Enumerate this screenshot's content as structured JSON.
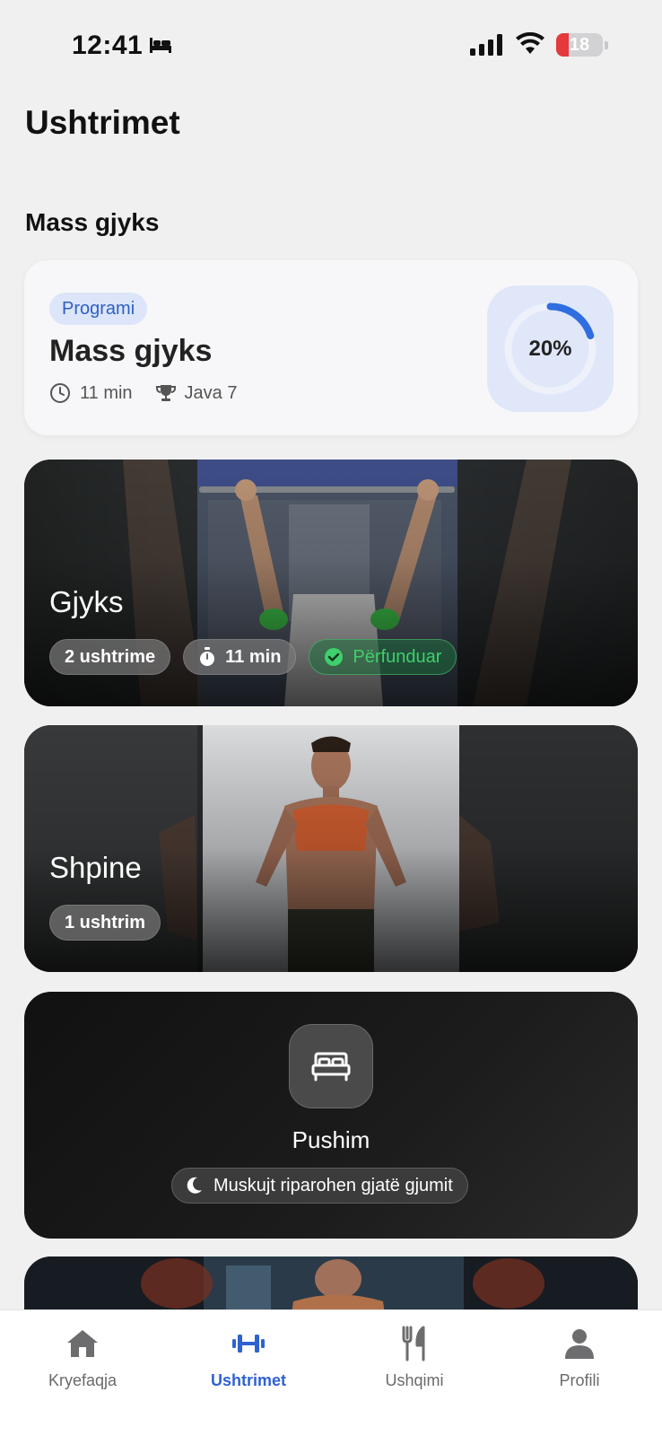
{
  "status": {
    "time": "12:41",
    "battery": "18"
  },
  "header": {
    "title": "Ushtrimet"
  },
  "section": {
    "title": "Mass gjyks"
  },
  "program": {
    "badge": "Programi",
    "name": "Mass gjyks",
    "duration": "11 min",
    "week": "Java 7",
    "progress_label": "20%",
    "progress_fraction": 0.2,
    "accent": "#2f6de0"
  },
  "workouts": [
    {
      "title": "Gjyks",
      "exercises": "2 ushtrime",
      "duration": "11 min",
      "status": "Përfunduar"
    },
    {
      "title": "Shpine",
      "exercises": "1 ushtrim"
    }
  ],
  "rest": {
    "title": "Pushim",
    "note": "Muskujt riparohen gjatë gjumit"
  },
  "tabs": [
    {
      "label": "Kryefaqja",
      "icon": "home-icon"
    },
    {
      "label": "Ushtrimet",
      "icon": "dumbbell-icon",
      "active": true
    },
    {
      "label": "Ushqimi",
      "icon": "fork-knife-icon"
    },
    {
      "label": "Profili",
      "icon": "person-icon"
    }
  ]
}
